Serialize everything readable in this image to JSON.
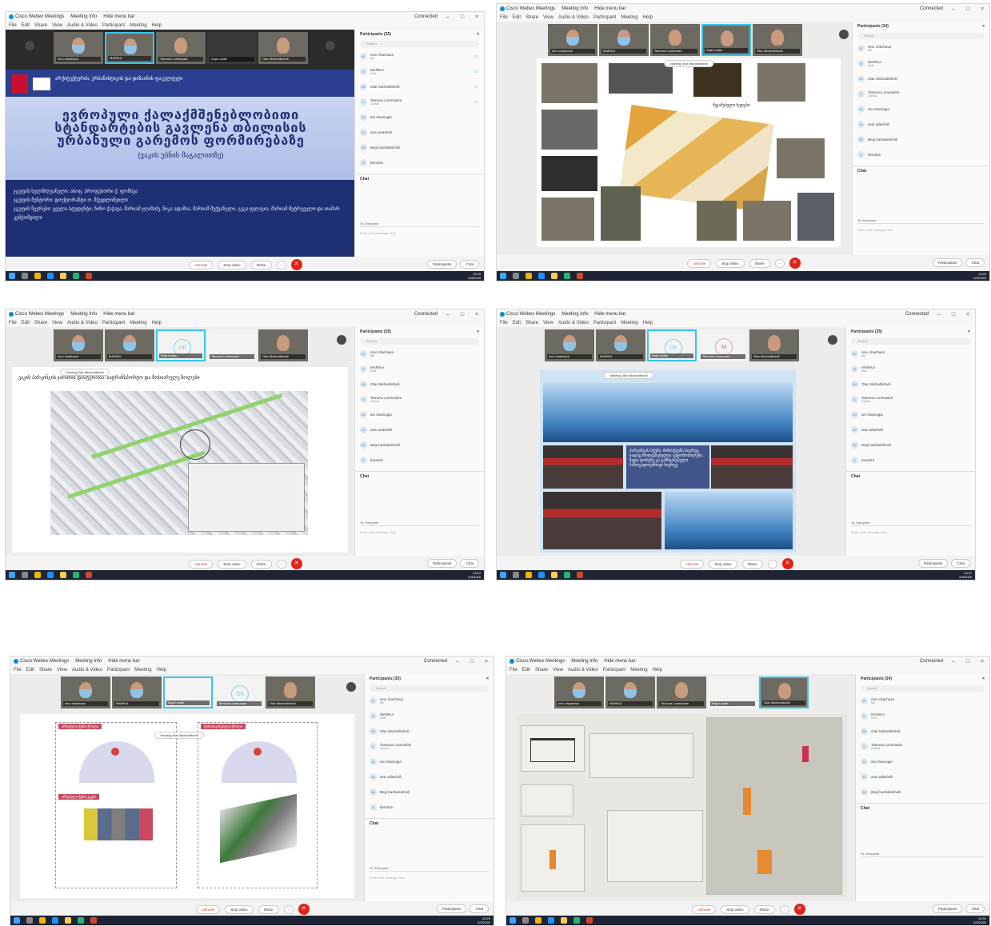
{
  "app": {
    "title": "Cisco Webex Meetings",
    "meeting_info": "Meeting Info",
    "hide_menu": "Hide menu bar",
    "connected": "Connected"
  },
  "menu": [
    "File",
    "Edit",
    "Share",
    "View",
    "Audio & Video",
    "Participant",
    "Meeting",
    "Help"
  ],
  "participants": {
    "header_35": "Participants (35)",
    "header_34": "Participants (34)",
    "search_placeholder": "Search",
    "list": [
      {
        "initials": "NC",
        "name": "nino chachava",
        "role": "Me"
      },
      {
        "initials": "M",
        "name": "MARIKA",
        "role": "Host"
      },
      {
        "initials": "OM",
        "name": "Otar Michedlishvili",
        "role": ""
      },
      {
        "initials": "TL",
        "name": "Tamuna Lominadze",
        "role": "Cohost"
      },
      {
        "initials": "AS",
        "name": "ani shamugia",
        "role": ""
      },
      {
        "initials": "AA",
        "name": "avto adashvili",
        "role": ""
      },
      {
        "initials": "BB",
        "name": "Begi bashaleishvili",
        "role": ""
      },
      {
        "initials": "B",
        "name": "beredze",
        "role": ""
      }
    ]
  },
  "chat": {
    "title": "Chat",
    "to_label": "To:",
    "to_value": "Everyone",
    "placeholder": "Enter chat message here"
  },
  "controls": {
    "unmute": "Unmute",
    "stop_video": "Stop video",
    "share": "Share",
    "more": "···",
    "end": "✕",
    "participants": "Participants",
    "chat": "Chat"
  },
  "viewing": "Viewing Otar Michedlishvili",
  "thumb_names": [
    "nino chachava",
    "MARIKA",
    "Tamuna Lominadze",
    "Otar Michedlishvili",
    "Anja Laube"
  ],
  "initials_ok": "OK",
  "initials_m": "M",
  "clock": {
    "t1": "13:15",
    "t2": "13:20",
    "t3": "13:24",
    "t4": "13:27",
    "t5": "13:29",
    "t6": "13:31",
    "date": "6/3/2020"
  },
  "slide1": {
    "university": "არქიტექტურის, ურბანისტიკის და დიზაინის ფაკულტეტი",
    "title_l1": "ევროპული ქალაქმშენებლობითი",
    "title_l2": "სტანდარტების გავლენა თბილისის",
    "title_l3": "ურბანული გარემოს ფორმირებაზე",
    "subtitle": "(ვაკის უბნის მაგალითზე)",
    "line1": "ჯგუფის ხელმძღვანელი: ასოც. პროფესორი ქ. ფოჩხუა",
    "line2": "ჯგუფის მენტორი: დოქტორანტი ო. მჭედლიშვილი",
    "line3": "ჯგუფის წევრები: ყველა სტუდენტი, ნინო ჭაჭავა, მარიამ ჯღამაძე, ნიკა ადამია, მარიამ შუქვანელი, გეგა ფლავია, მარიამ მეტრეველი და თამარ კენჭოშვილი"
  },
  "slide2": {
    "caption": "შეჯამებული ხედები"
  },
  "slide3": {
    "caption": "ვაკის პარკინგის ჯარიმის დასტურობა: სატრანსპორტო და მოსიარულე ზოლები"
  },
  "slide4": {
    "caption": "პარკინგის სქემა: მიწისქვეშა სივრცე, სადაც მოთავსებულია ავტომობილები, ზედა დონეზე კი გამწვანებული საზოგადოებრივი სივრცე"
  },
  "slide5": {
    "tag1": "არსებული ქუჩის ჭრილი",
    "tag2": "შემოთავაზებული ჭრილი",
    "tag3": "არსებული ქუჩის გეგმა"
  },
  "chat_to_alt": "Everyone"
}
